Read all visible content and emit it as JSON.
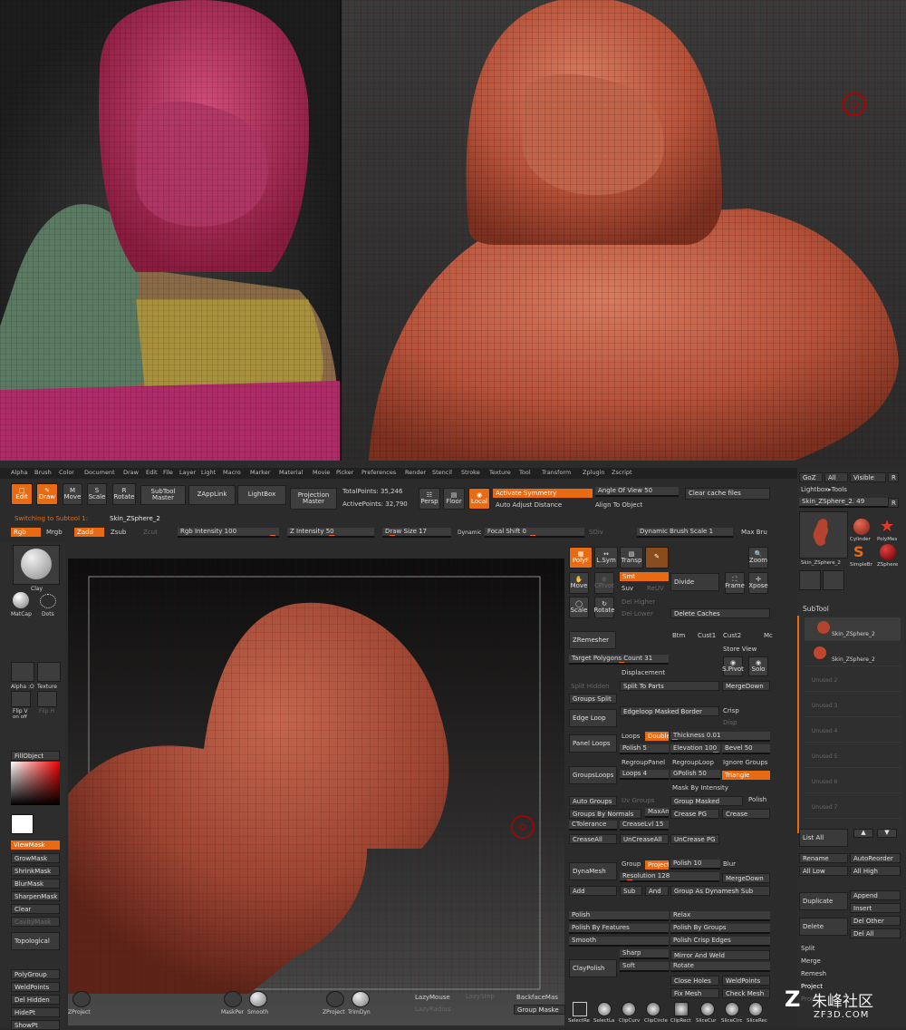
{
  "menu": [
    "Alpha",
    "Brush",
    "Color",
    "Document",
    "Draw",
    "Edit",
    "File",
    "Layer",
    "Light",
    "Macro",
    "Marker",
    "Material",
    "Movie",
    "Picker",
    "Preferences",
    "Render",
    "Stencil",
    "Stroke",
    "Texture",
    "Tool",
    "Transform",
    "Zplugin",
    "Zscript"
  ],
  "toolbar": {
    "edit": "Edit",
    "draw": "Draw",
    "move": "Move",
    "scale": "Scale",
    "rotate": "Rotate",
    "subtool_master": "SubTool Master",
    "zapplink": "ZAppLink",
    "lightbox": "LightBox",
    "projection_master": "Projection Master",
    "total_points": "TotalPoints: 35,246",
    "active_points": "ActivePoints: 32,790",
    "persp": "Persp",
    "floor": "Floor",
    "local": "Local",
    "activate_symmetry": "Activate Symmetry",
    "auto_adjust_distance": "Auto Adjust Distance",
    "angle_of_view": "Angle Of View 50",
    "align_to_object": "Align To Object",
    "clear_cache": "Clear cache files"
  },
  "status": {
    "switching": "Switching to Subtool 1:",
    "subtool_name": "Skin_ZSphere_2"
  },
  "row3": {
    "rgb": "Rgb",
    "mrgb": "Mrgb",
    "zadd": "Zadd",
    "zsub": "Zsub",
    "zcut": "Zcut",
    "rgb_intensity": "Rgb Intensity 100",
    "z_intensity": "Z Intensity 50",
    "draw_size": "Draw Size 17",
    "dynamic": "Dynamic",
    "focal_shift": "Focal Shift 0",
    "sdiv": "SDiv",
    "dynamic_brush_scale": "Dynamic Brush Scale 1",
    "max_bru": "Max Bru"
  },
  "left": {
    "clay": "Clay",
    "matcap": "MatCap",
    "dots": "Dots",
    "alpha": "Alpha :O",
    "texture": "Texture",
    "flip_v": "Flip V",
    "flip_h": "Flip H",
    "on_off": "on  off",
    "fill_object": "FillObject",
    "viewmask": "ViewMask",
    "growmask": "GrowMask",
    "shrinkmask": "ShrinkMask",
    "blurmask": "BlurMask",
    "sharpenmask": "SharpenMask",
    "clear": "Clear",
    "cavitymask": "CavityMask",
    "topological": "Topological",
    "polygroup": "PolyGroup",
    "weldpoints": "WeldPoints",
    "del_hidden": "Del Hidden",
    "hidept": "HidePt",
    "showpt": "ShowPt"
  },
  "bottom": {
    "zproject": "ZProject",
    "maskper": "MaskPer",
    "smooth": "Smooth",
    "zproject2": "ZProject",
    "trimdyn": "TrimDyn",
    "lazymouse": "LazyMouse",
    "lazystep": "LazyStep",
    "lazyradius": "LazyRadius",
    "backfacemask": "BackfaceMas",
    "group_mask": "Group Maske",
    "tools": [
      "SelectRe",
      "SelectLa",
      "ClipCurv",
      "ClipCircle",
      "ClipRect",
      "SliceCur",
      "SliceCirc",
      "SliceRec"
    ]
  },
  "mid": {
    "polyf": "PolyF",
    "lsym": "L.Sym",
    "transp": "Transp",
    "ghost": "Ghost",
    "move": "Move",
    "cpivot": "CPivot",
    "scale": "Scale",
    "rotate": "Rotate",
    "smt": "Smt",
    "suv": "Suv",
    "reuv": "ReUV",
    "divide": "Divide",
    "del_higher": "Del Higher",
    "del_lower": "Del Lower",
    "delete_caches": "Delete Caches",
    "frame": "Frame",
    "xpose": "Xpose",
    "zoom": "Zoom",
    "zremesher": "ZRemesher",
    "btm": "Btm",
    "cust1": "Cust1",
    "cust2": "Cust2",
    "mc": "Mc",
    "target_polygons": "Target Polygons Count 31",
    "store_view": "Store View",
    "spivot": "S.Pivot",
    "solo": "Solo",
    "transp2": "Transp",
    "displacement": "Displacement",
    "split_hidden": "Split Hidden",
    "split_to_parts": "Split To Parts",
    "mergedown": "MergeDown",
    "groups_split": "Groups Split",
    "edge_loop": "Edge Loop",
    "edgeloop_masked_border": "Edgeloop Masked Border",
    "crisp": "Crisp",
    "disp": "Disp",
    "panel_loops": "Panel Loops",
    "loops": "Loops",
    "double": "Double",
    "thickness": "Thickness 0.01",
    "polish5": "Polish 5",
    "elevation": "Elevation 100",
    "bevel": "Bevel 50",
    "groupsloops": "GroupsLoops",
    "regrouppanel": "RegroupPanel",
    "regrouploop": "RegroupLoop",
    "ignore_groups": "Ignore Groups",
    "loops4": "Loops 4",
    "gpolish": "GPolish 50",
    "triangle": "Triangle",
    "mask_by_intensity": "Mask By Intensity",
    "auto_groups": "Auto Groups",
    "uv_groups": "Uv Groups",
    "group_masked": "Group Masked",
    "polish": "Polish",
    "groups_by_normals": "Groups By Normals",
    "maxangle": "MaxAngle",
    "crease_pg": "Crease PG",
    "crease": "Crease",
    "ctolerance": "CTolerance",
    "creaselvl": "CreaseLvl 15",
    "creaseall": "CreaseAll",
    "uncreaseall": "UnCreaseAll",
    "uncrease_pg": "UnCrease PG",
    "dynamesh": "DynaMesh",
    "group": "Group",
    "project": "Project",
    "polish10": "Polish 10",
    "blur": "Blur",
    "resolution": "Resolution 128",
    "mergedown2": "MergeDown",
    "add": "Add",
    "sub": "Sub",
    "and": "And",
    "group_as_dynamesh": "Group As Dynamesh Sub",
    "polish_b": "Polish",
    "relax": "Relax",
    "polish_by_features": "Polish By Features",
    "polish_by_groups": "Polish By Groups",
    "smooth": "Smooth",
    "polish_crisp_edges": "Polish Crisp Edges",
    "claypolish": "ClayPolish",
    "sharp": "Sharp",
    "soft": "Soft",
    "mirror_and_weld": "Mirror And Weld",
    "rotate2": "Rotate",
    "close_holes": "Close Holes",
    "weldpoints": "WeldPoints",
    "fix_mesh": "Fix Mesh",
    "check_mesh": "Check Mesh"
  },
  "right": {
    "goz": "GoZ",
    "all": "All",
    "visible": "Visible",
    "r": "R",
    "lightbox_tools": "Lightbox▸Tools",
    "tool_name": "Skin_ZSphere_2. 49",
    "thumbs": [
      "Skin_ZSphere_2",
      "Cylinder",
      "PolyMes",
      "SimpleBr",
      "ZSphere"
    ],
    "subtool": "SubTool",
    "slots": [
      "Skin_ZSphere_2",
      "Skin_ZSphere_2",
      "Unused 2",
      "Unused 3",
      "Unused 4",
      "Unused 5",
      "Unused 6",
      "Unused 7"
    ],
    "list_all": "List All",
    "rename": "Rename",
    "autoreorder": "AutoReorder",
    "all_low": "All Low",
    "all_high": "All High",
    "duplicate": "Duplicate",
    "append": "Append",
    "insert": "Insert",
    "delete": "Delete",
    "del_other": "Del Other",
    "del_all": "Del All",
    "split": "Split",
    "merge": "Merge",
    "remesh": "Remesh",
    "project": "Project",
    "proj": "Proj"
  },
  "watermark": "朱峰社区",
  "watermark_sub": "ZF3D.COM"
}
